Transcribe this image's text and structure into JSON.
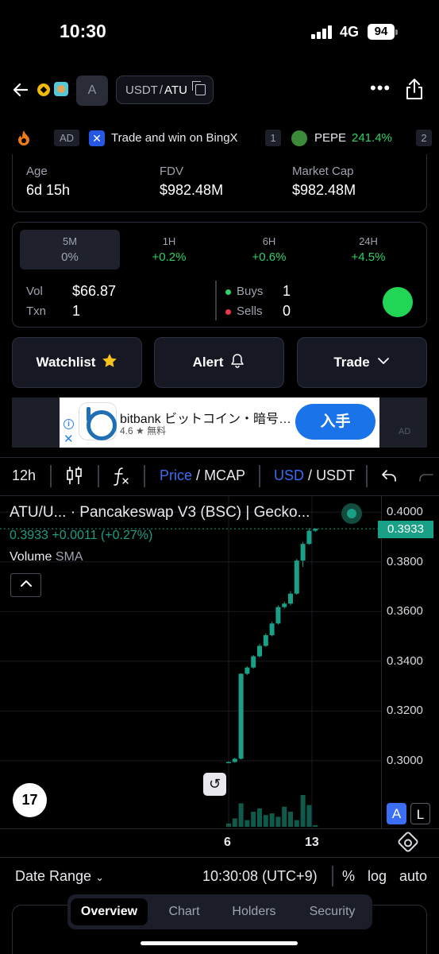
{
  "status": {
    "time": "10:30",
    "network": "4G",
    "battery": "94"
  },
  "nav": {
    "token_initial": "A",
    "pair_quote": "USDT",
    "pair_sep": "/",
    "pair_base": "ATU",
    "more": "•••"
  },
  "ticker": {
    "ad_label": "AD",
    "ad_text": "Trade and win on BingX",
    "rank1": "1",
    "token_name": "PEPE",
    "token_change": "241.4%",
    "rank2": "2"
  },
  "stats": {
    "age_label": "Age",
    "age_value": "6d 15h",
    "fdv_label": "FDV",
    "fdv_value": "$982.48M",
    "mcap_label": "Market Cap",
    "mcap_value": "$982.48M"
  },
  "timeframes": [
    {
      "label": "5M",
      "value": "0%"
    },
    {
      "label": "1H",
      "value": "+0.2%"
    },
    {
      "label": "6H",
      "value": "+0.6%"
    },
    {
      "label": "24H",
      "value": "+4.5%"
    }
  ],
  "activity": {
    "vol_label": "Vol",
    "vol_value": "$66.87",
    "txn_label": "Txn",
    "txn_value": "1",
    "buys_label": "Buys",
    "buys_value": "1",
    "sells_label": "Sells",
    "sells_value": "0"
  },
  "actions": {
    "watchlist": "Watchlist",
    "alert": "Alert",
    "trade": "Trade"
  },
  "banner_ad": {
    "title": "bitbank ビットコイン・暗号…",
    "rating": "4.6 ★ 無料",
    "cta": "入手",
    "corner": "AD"
  },
  "chart_toolbar": {
    "interval": "12h",
    "price": "Price",
    "mcap": "MCAP",
    "usd": "USD",
    "usdt": "USDT",
    "slash": "/"
  },
  "chart_header": {
    "title": "ATU/U... · Pancakeswap V3 (BSC) | Gecko...",
    "ohlc": "0.3933  +0.0011 (+0.27%)",
    "volume_label": "Volume",
    "volume_ind": "SMA"
  },
  "chart_data": {
    "type": "candlestick",
    "title": "ATU/U... · Pancakeswap V3 (BSC) | Gecko...",
    "yticks": [
      "0.4000",
      "0.3800",
      "0.3600",
      "0.3400",
      "0.3200",
      "0.3000"
    ],
    "ylim": [
      0.2955,
      0.4058
    ],
    "last_price": "0.3933",
    "xticks": [
      "6",
      "13"
    ],
    "candles": [
      {
        "o": 0.2993,
        "h": 0.2997,
        "l": 0.299,
        "c": 0.2995
      },
      {
        "o": 0.2995,
        "h": 0.3012,
        "l": 0.2992,
        "c": 0.3008
      },
      {
        "o": 0.3008,
        "h": 0.3351,
        "l": 0.3005,
        "c": 0.335
      },
      {
        "o": 0.335,
        "h": 0.338,
        "l": 0.3345,
        "c": 0.3375
      },
      {
        "o": 0.3375,
        "h": 0.3425,
        "l": 0.337,
        "c": 0.342
      },
      {
        "o": 0.342,
        "h": 0.347,
        "l": 0.3415,
        "c": 0.3462
      },
      {
        "o": 0.3462,
        "h": 0.3512,
        "l": 0.3458,
        "c": 0.3505
      },
      {
        "o": 0.3505,
        "h": 0.356,
        "l": 0.35,
        "c": 0.3552
      },
      {
        "o": 0.3552,
        "h": 0.3625,
        "l": 0.3548,
        "c": 0.3618
      },
      {
        "o": 0.3618,
        "h": 0.364,
        "l": 0.3612,
        "c": 0.3632
      },
      {
        "o": 0.3632,
        "h": 0.3682,
        "l": 0.3625,
        "c": 0.3672
      },
      {
        "o": 0.3672,
        "h": 0.3812,
        "l": 0.3668,
        "c": 0.3805
      },
      {
        "o": 0.3805,
        "h": 0.388,
        "l": 0.378,
        "c": 0.3872
      },
      {
        "o": 0.3872,
        "h": 0.3935,
        "l": 0.3868,
        "c": 0.3925
      },
      {
        "o": 0.3925,
        "h": 0.3935,
        "l": 0.392,
        "c": 0.3933
      }
    ],
    "volumes": [
      2,
      5,
      14,
      4,
      9,
      11,
      7,
      8,
      6,
      12,
      9,
      4,
      19,
      13,
      1
    ],
    "grid": true,
    "color_up": "#1aa086"
  },
  "chart_controls": {
    "a": "A",
    "l": "L"
  },
  "footer": {
    "date_range": "Date Range",
    "time": "10:30:08 (UTC+9)",
    "pct": "%",
    "log": "log",
    "auto": "auto"
  },
  "tabs": [
    {
      "label": "Overview",
      "active": true
    },
    {
      "label": "Chart",
      "active": false
    },
    {
      "label": "Holders",
      "active": false
    },
    {
      "label": "Security",
      "active": false
    }
  ]
}
